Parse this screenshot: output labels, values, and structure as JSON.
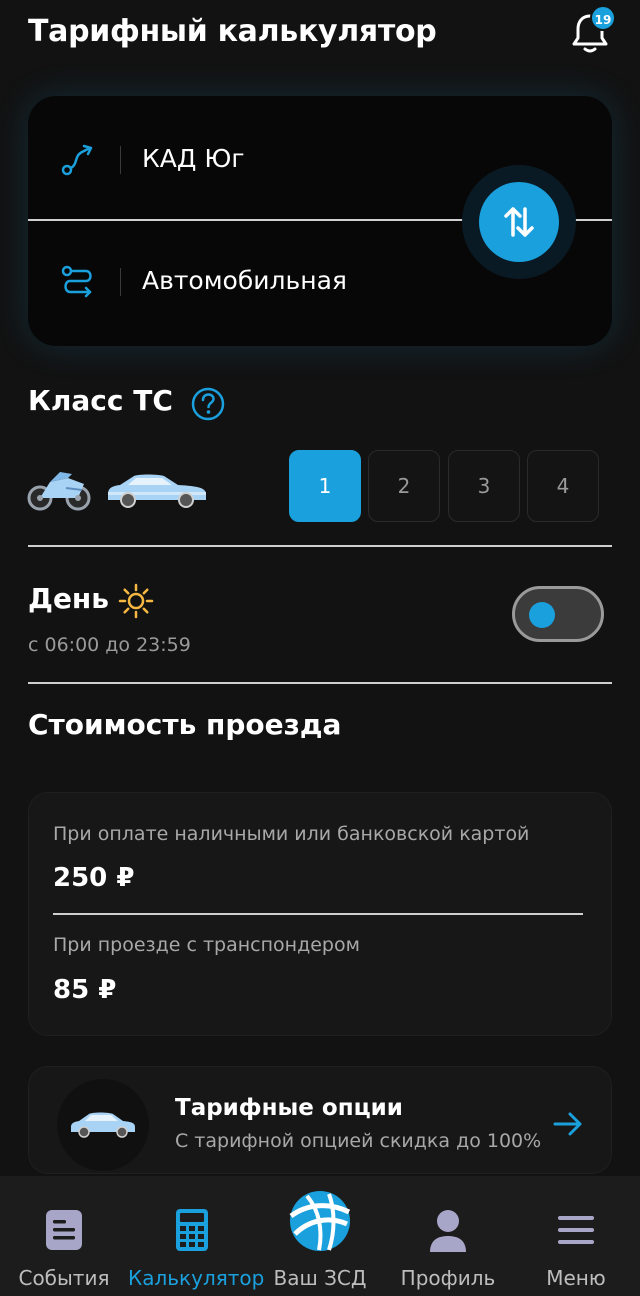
{
  "header": {
    "title": "Тарифный калькулятор",
    "notifications_count": "19"
  },
  "route": {
    "from": "КАД Юг",
    "to": "Автомобильная"
  },
  "vehicle_class": {
    "title": "Класс ТС",
    "options": [
      "1",
      "2",
      "3",
      "4"
    ],
    "selected": "1"
  },
  "time_period": {
    "title": "День",
    "subtitle": "с 06:00 до 23:59",
    "toggle_state": "day"
  },
  "cost": {
    "title": "Стоимость проезда",
    "cash_label": "При оплате наличными или банковской картой",
    "cash_price": "250 ₽",
    "transponder_label": "При проезде с транспондером",
    "transponder_price": "85 ₽"
  },
  "tariff_options": {
    "title": "Тарифные опции",
    "subtitle": "С тарифной опцией скидка до 100%"
  },
  "nav": {
    "events": "События",
    "calculator": "Калькулятор",
    "zsd": "Ваш ЗСД",
    "profile": "Профиль",
    "menu": "Меню",
    "active": "calculator"
  },
  "colors": {
    "accent": "#1aa0dc",
    "background": "#121212",
    "card": "#171717"
  }
}
